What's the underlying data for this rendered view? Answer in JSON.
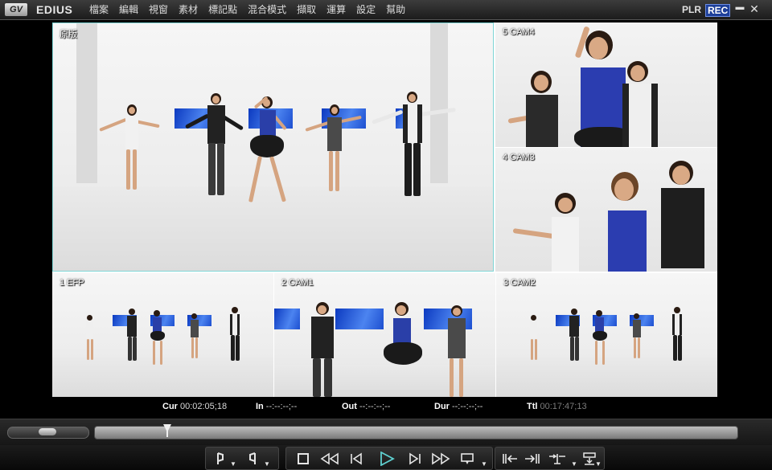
{
  "app": {
    "logo": "GV",
    "name": "EDIUS",
    "mode_plr": "PLR",
    "mode_rec": "REC",
    "minimize_glyph": "▬",
    "close_glyph": "✕"
  },
  "menu": [
    "檔案",
    "編輯",
    "視窗",
    "素材",
    "標記點",
    "混合模式",
    "擷取",
    "運算",
    "設定",
    "幫助"
  ],
  "cameras": {
    "main": "原版",
    "cam4": "5 CAM4",
    "cam3": "4 CAM3",
    "efp": "1 EFP",
    "cam1": "2 CAM1",
    "cam2": "3 CAM2"
  },
  "timecodes": {
    "cur": {
      "label": "Cur",
      "value": "00:02:05;18"
    },
    "in": {
      "label": "In",
      "value": "--:--:--;--"
    },
    "out": {
      "label": "Out",
      "value": "--:--:--;--"
    },
    "dur": {
      "label": "Dur",
      "value": "--:--:--;--"
    },
    "ttl": {
      "label": "Ttl",
      "value": "00:17:47;13"
    }
  },
  "playback": {
    "position_fraction": 0.114
  },
  "controls": {
    "icons": [
      "set-in-icon",
      "set-out-icon",
      "stop-icon",
      "rewind-icon",
      "step-back-icon",
      "play-icon",
      "step-forward-icon",
      "fast-forward-icon",
      "loop-icon",
      "insert-to-timeline-icon",
      "overwrite-to-timeline-icon",
      "split-icon",
      "export-icon"
    ]
  },
  "colors": {
    "rec_accent": "#1d3f9a",
    "active_camera_border": "#7fd6d6",
    "play_accent": "#5fd0d0"
  }
}
